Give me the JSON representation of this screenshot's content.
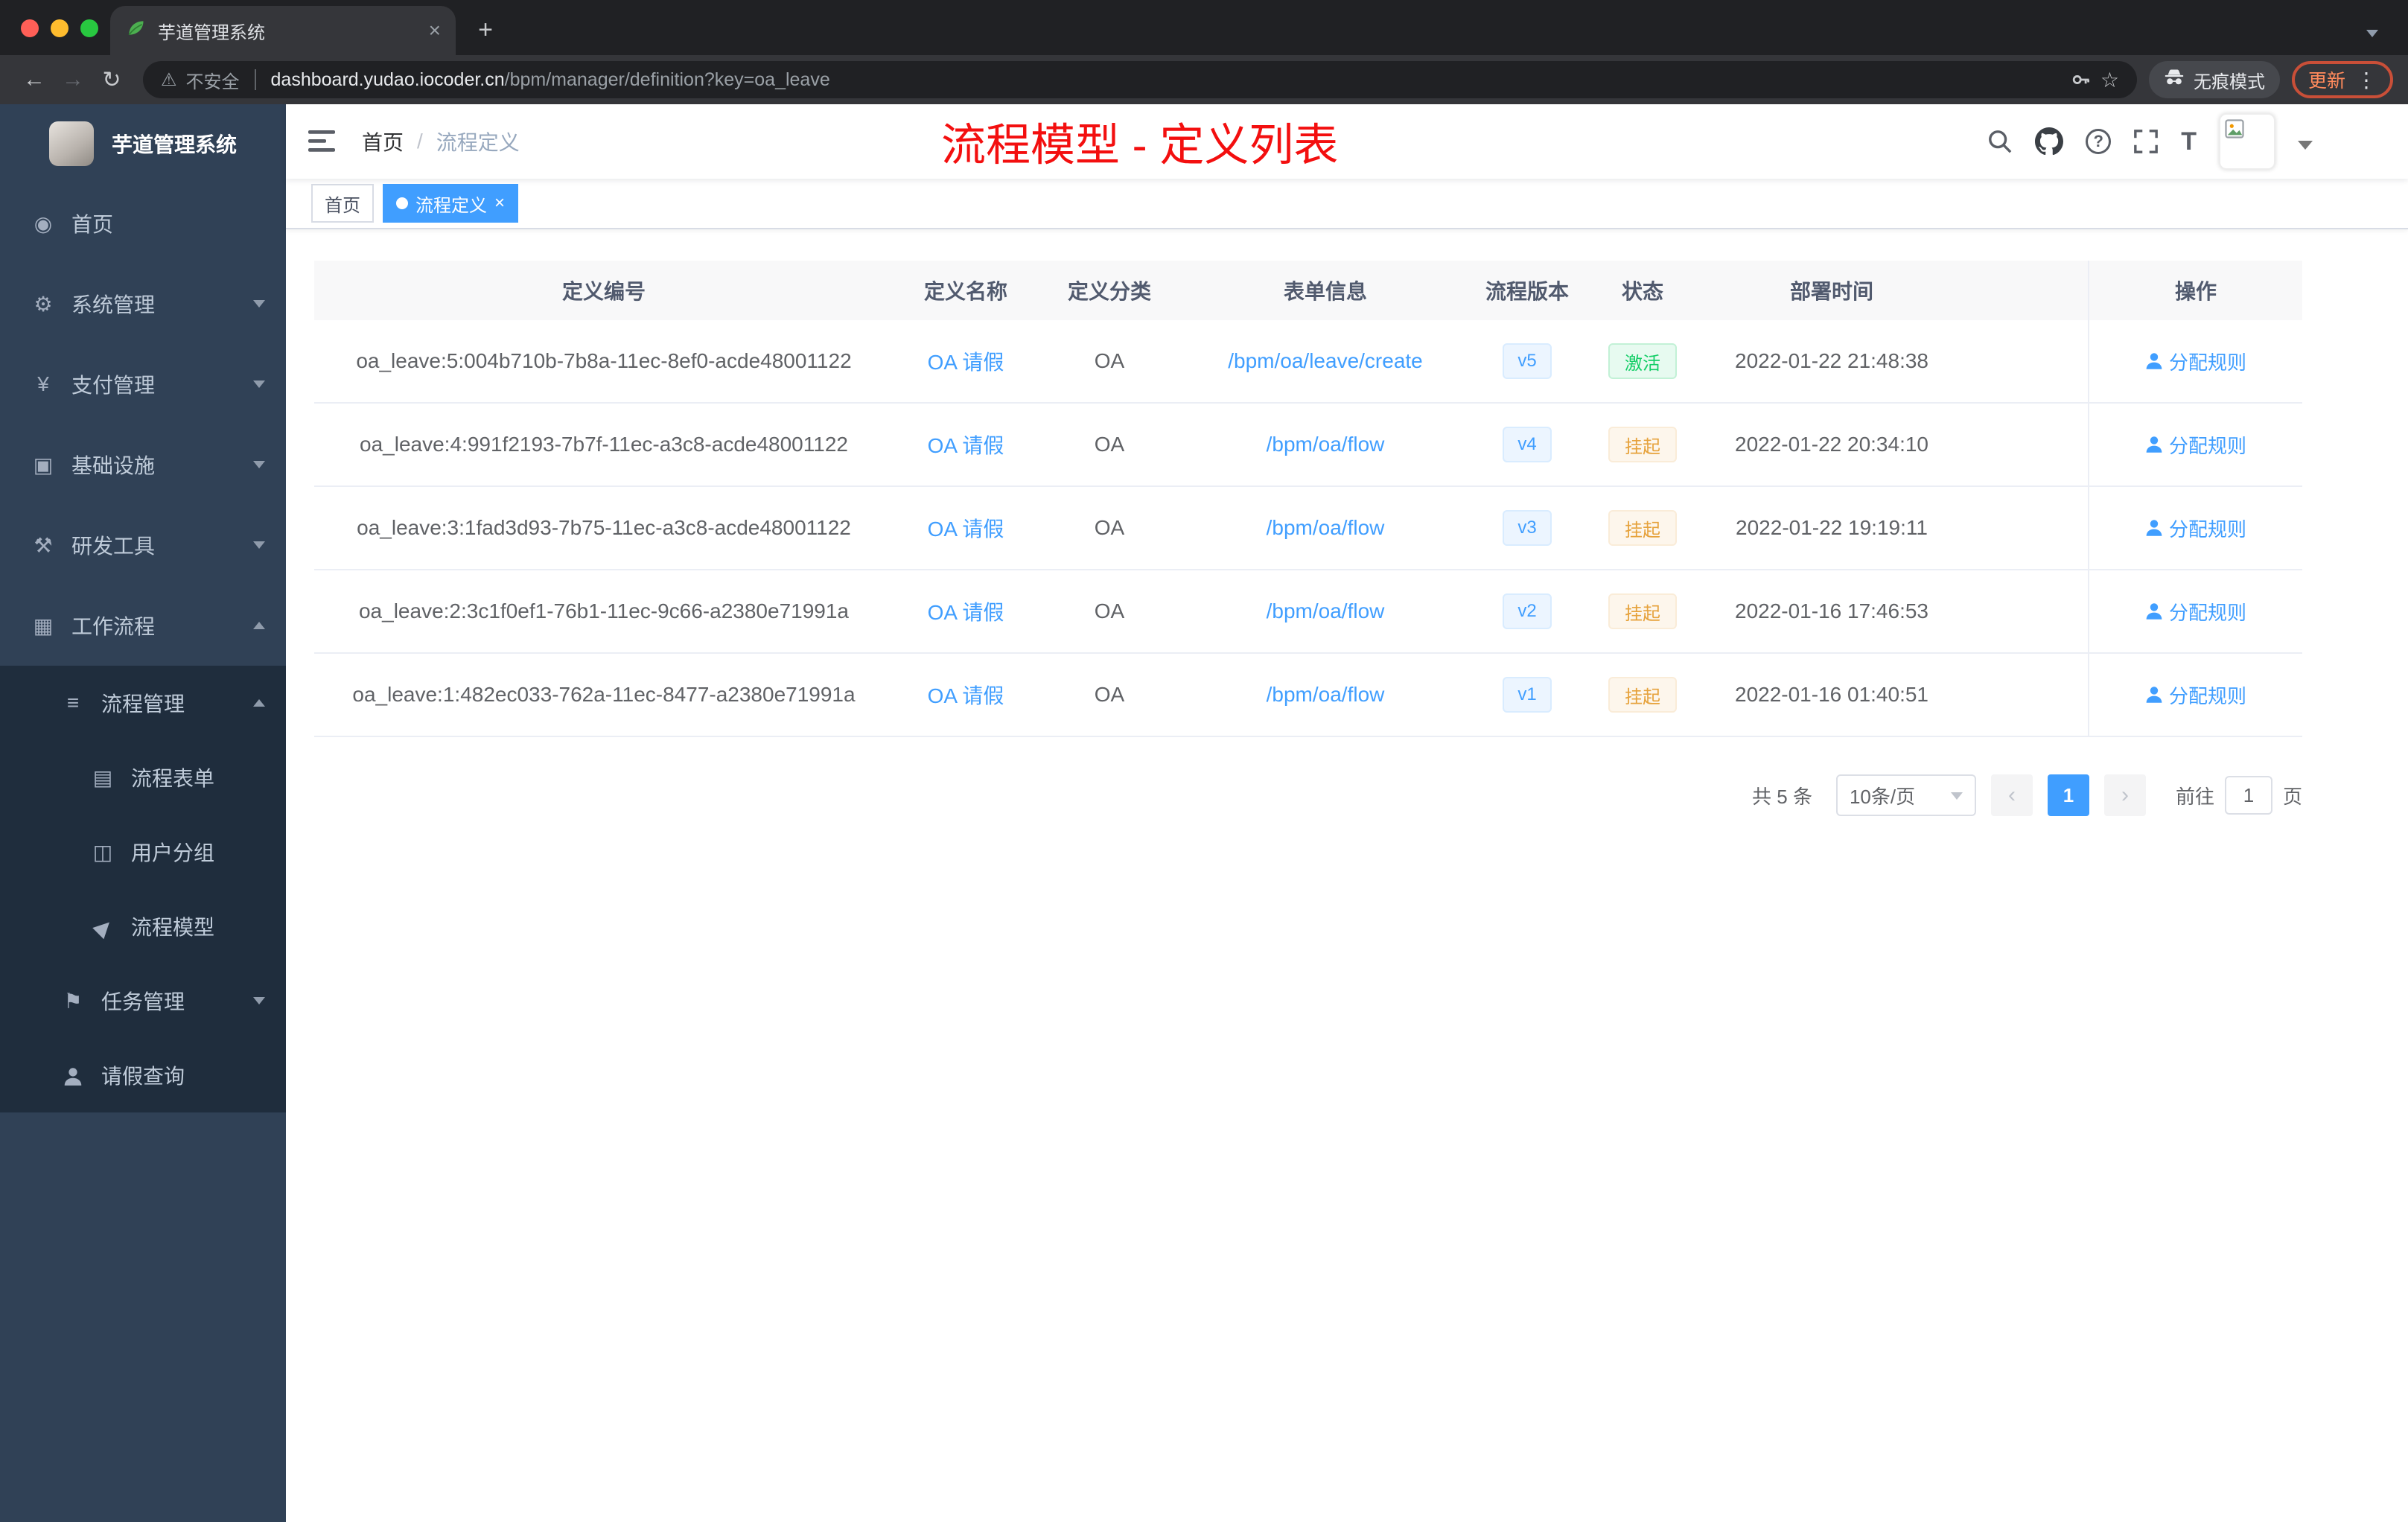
{
  "browser": {
    "tab_title": "芋道管理系统",
    "security_label": "不安全",
    "url_domain": "dashboard.yudao.iocoder.cn",
    "url_path": "/bpm/manager/definition?key=oa_leave",
    "incognito_label": "无痕模式",
    "update_label": "更新"
  },
  "sidebar": {
    "logo_title": "芋道管理系统",
    "menu": [
      {
        "label": "首页"
      },
      {
        "label": "系统管理"
      },
      {
        "label": "支付管理"
      },
      {
        "label": "基础设施"
      },
      {
        "label": "研发工具"
      },
      {
        "label": "工作流程"
      },
      {
        "label": "流程管理"
      },
      {
        "label": "流程表单"
      },
      {
        "label": "用户分组"
      },
      {
        "label": "流程模型"
      },
      {
        "label": "任务管理"
      },
      {
        "label": "请假查询"
      }
    ]
  },
  "header": {
    "breadcrumb_home": "首页",
    "breadcrumb_current": "流程定义",
    "annotation": "流程模型 - 定义列表"
  },
  "tags": {
    "home": "首页",
    "active": "流程定义"
  },
  "table": {
    "columns": {
      "id": "定义编号",
      "name": "定义名称",
      "category": "定义分类",
      "form": "表单信息",
      "version": "流程版本",
      "status": "状态",
      "deploy_time": "部署时间",
      "actions": "操作"
    },
    "rows": [
      {
        "id": "oa_leave:5:004b710b-7b8a-11ec-8ef0-acde48001122",
        "name": "OA 请假",
        "category": "OA",
        "form": "/bpm/oa/leave/create",
        "version": "v5",
        "status": "激活",
        "status_type": "success",
        "deploy_time": "2022-01-22 21:48:38",
        "action": "分配规则"
      },
      {
        "id": "oa_leave:4:991f2193-7b7f-11ec-a3c8-acde48001122",
        "name": "OA 请假",
        "category": "OA",
        "form": "/bpm/oa/flow",
        "version": "v4",
        "status": "挂起",
        "status_type": "warning",
        "deploy_time": "2022-01-22 20:34:10",
        "action": "分配规则"
      },
      {
        "id": "oa_leave:3:1fad3d93-7b75-11ec-a3c8-acde48001122",
        "name": "OA 请假",
        "category": "OA",
        "form": "/bpm/oa/flow",
        "version": "v3",
        "status": "挂起",
        "status_type": "warning",
        "deploy_time": "2022-01-22 19:19:11",
        "action": "分配规则"
      },
      {
        "id": "oa_leave:2:3c1f0ef1-76b1-11ec-9c66-a2380e71991a",
        "name": "OA 请假",
        "category": "OA",
        "form": "/bpm/oa/flow",
        "version": "v2",
        "status": "挂起",
        "status_type": "warning",
        "deploy_time": "2022-01-16 17:46:53",
        "action": "分配规则"
      },
      {
        "id": "oa_leave:1:482ec033-762a-11ec-8477-a2380e71991a",
        "name": "OA 请假",
        "category": "OA",
        "form": "/bpm/oa/flow",
        "version": "v1",
        "status": "挂起",
        "status_type": "warning",
        "deploy_time": "2022-01-16 01:40:51",
        "action": "分配规则"
      }
    ]
  },
  "pagination": {
    "total": "共 5 条",
    "page_size": "10条/页",
    "prev": "‹",
    "next": "›",
    "current_page": "1",
    "goto_label": "前往",
    "goto_value": "1",
    "unit": "页"
  },
  "icons": {
    "back": "←",
    "forward": "→",
    "reload": "↻",
    "warning": "⚠",
    "star": "☆",
    "tab_close": "×",
    "new_tab": "+",
    "more_menu": "⋮",
    "tag_close": "×",
    "breadcrumb_sep": "/",
    "home": "◉",
    "gear": "⚙",
    "yuan": "¥",
    "infra": "▣",
    "tools": "⚒",
    "workflow": "▦",
    "list": "≡",
    "form": "▤",
    "group": "◫",
    "send": "▶",
    "flag": "⚑",
    "question": "?",
    "font_size": "T"
  },
  "colors": {
    "accent": "#409eff",
    "success_text": "#13ce66",
    "success_bg": "#e7faf0",
    "warning_text": "#e6a23c",
    "warning_bg": "#fdf6ec",
    "annotation": "#f30f0f",
    "sidebar_bg": "#304156",
    "submenu_bg": "#1f2d3d",
    "active_tag": "#409eff"
  }
}
